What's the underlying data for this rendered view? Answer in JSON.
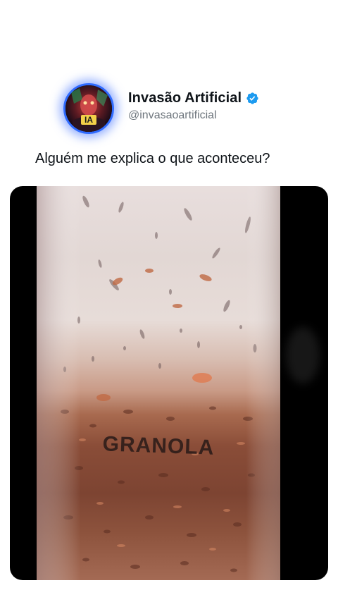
{
  "post": {
    "author": {
      "display_name": "Invasão Artificial",
      "handle": "@invasaoartificial",
      "avatar_icon": "ia-avatar-icon",
      "avatar_badge_text": "IA",
      "verified_icon": "verified-badge-icon",
      "verified_color": "#1d9bf0"
    },
    "text": "Alguém me explica o que aconteceu?",
    "media": {
      "type": "video-frame",
      "label_text": "GRANOLA"
    }
  },
  "colors": {
    "background": "#ffffff",
    "name_text": "#0f1419",
    "handle_text": "#6e767d",
    "avatar_ring": "#2f6bff"
  }
}
